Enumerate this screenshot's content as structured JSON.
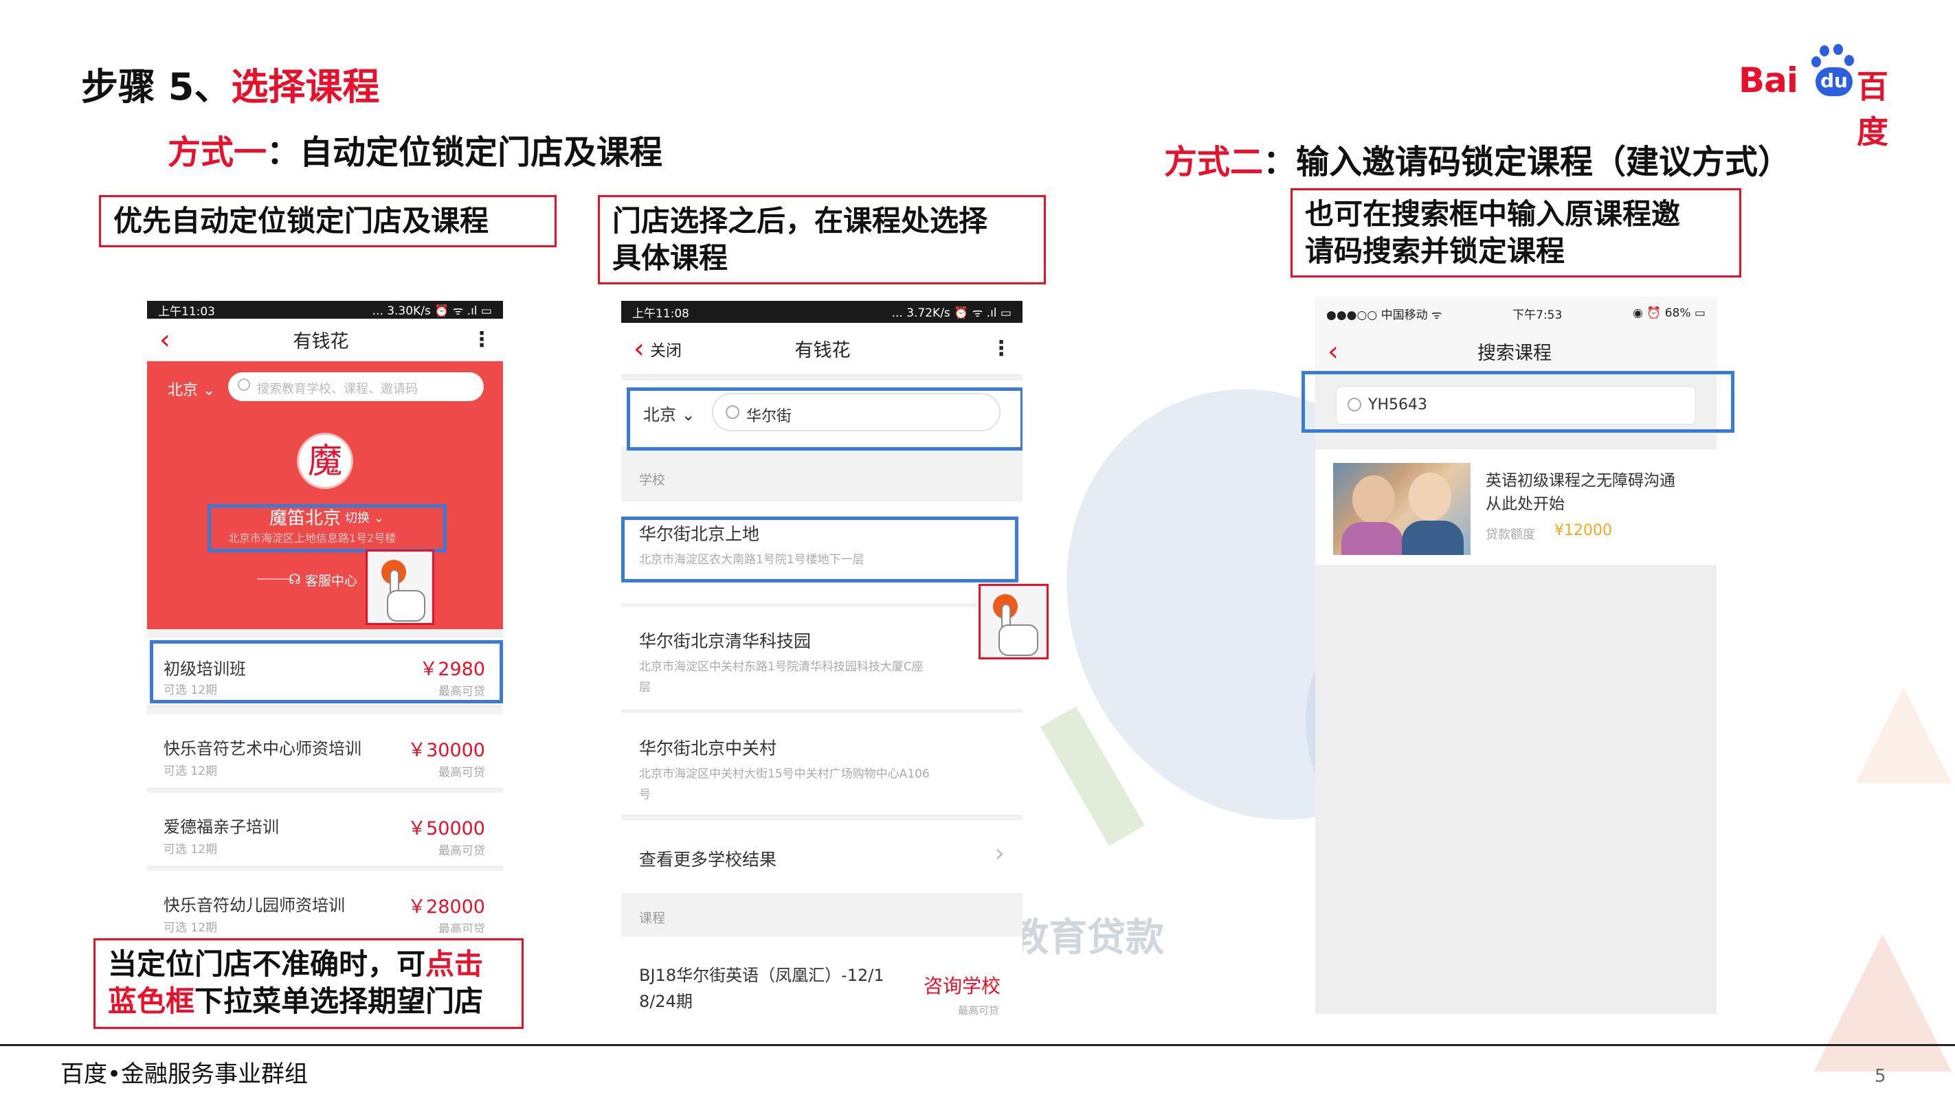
{
  "header": {
    "step": "步骤 5、",
    "step_highlight": "选择课程"
  },
  "logo": {
    "text_en": "Bai",
    "text_du": "du",
    "text_cn": "百度"
  },
  "method1": {
    "label": "方式一",
    "sep": "：",
    "text": "自动定位锁定门店及课程"
  },
  "method2": {
    "label": "方式二",
    "sep": "：",
    "text": "输入邀请码锁定课程（建议方式）"
  },
  "callouts": {
    "c1": "优先自动定位锁定门店及课程",
    "c2_l1": "门店选择之后，在课程处选择",
    "c2_l2": "具体课程",
    "c3_l1": "也可在搜索框中输入原课程邀",
    "c3_l2": "请码搜索并锁定课程",
    "c4_l1": "当定位门店不准确时，可",
    "c4_l1_red": "点击",
    "c4_l2_red": "蓝色框",
    "c4_l2": "下拉菜单选择期望门店"
  },
  "phone1": {
    "status_time": "上午11:03",
    "status_right": "... 3.30K/s ⏰ ᯤ .ıl ▭",
    "title": "有钱花",
    "city": "北京 ⌄",
    "search_placeholder": "搜索教育学校、课程、邀请码",
    "avatar_char": "魔",
    "store_name": "魔笛北京",
    "store_tag": "切换 ⌄",
    "store_addr": "北京市海淀区上地信息路1号2号楼",
    "service": "客服中心",
    "courses": [
      {
        "name": "初级培训班",
        "sub": "可选 12期",
        "price": "￥2980",
        "price_sub": "最高可贷"
      },
      {
        "name": "快乐音符艺术中心师资培训",
        "sub": "可选 12期",
        "price": "￥30000",
        "price_sub": "最高可贷"
      },
      {
        "name": "爱德福亲子培训",
        "sub": "可选 12期",
        "price": "￥50000",
        "price_sub": "最高可贷"
      },
      {
        "name": "快乐音符幼儿园师资培训",
        "sub": "可选 12期",
        "price": "￥28000",
        "price_sub": "最高可贷"
      }
    ]
  },
  "phone2": {
    "status_time": "上午11:08",
    "status_right": "... 3.72K/s ⏰ ᯤ .ıl ▭",
    "close": "关闭",
    "title": "有钱花",
    "city": "北京 ⌄",
    "search_value": "华尔街",
    "section_school": "学校",
    "schools": [
      {
        "name": "华尔街北京上地",
        "addr": "北京市海淀区农大南路1号院1号楼地下一层"
      },
      {
        "name": "华尔街北京清华科技园",
        "addr": "北京市海淀区中关村东路1号院清华科技园科技大厦C座",
        "addr2": "层"
      },
      {
        "name": "华尔街北京中关村",
        "addr": "北京市海淀区中关村大街15号中关村广场购物中心A106",
        "addr2": "号"
      }
    ],
    "more": "查看更多学校结果",
    "section_course": "课程",
    "course_name_l1": "BJ18华尔街英语（凤凰汇）-12/1",
    "course_name_l2": "8/24期",
    "consult": "咨询学校",
    "consult_sub": "最高可贷"
  },
  "phone3": {
    "status_left": "●●●○○ 中国移动 ᯤ",
    "status_time": "下午7:53",
    "status_right": "◉ ⏰ 68% ▭",
    "title": "搜索课程",
    "search_value": "YH5643",
    "course_title_l1": "英语初级课程之无障碍沟通",
    "course_title_l2": "从此处开始",
    "loan_label": "贷款额度",
    "loan_value": "¥12000"
  },
  "watermark": "教育贷款",
  "footer": {
    "org": "百度•金融服务事业群组",
    "page": "5"
  },
  "colors": {
    "red": "#e8102a",
    "blue": "#3a7bd5",
    "phone_red": "#ef4a4a"
  }
}
